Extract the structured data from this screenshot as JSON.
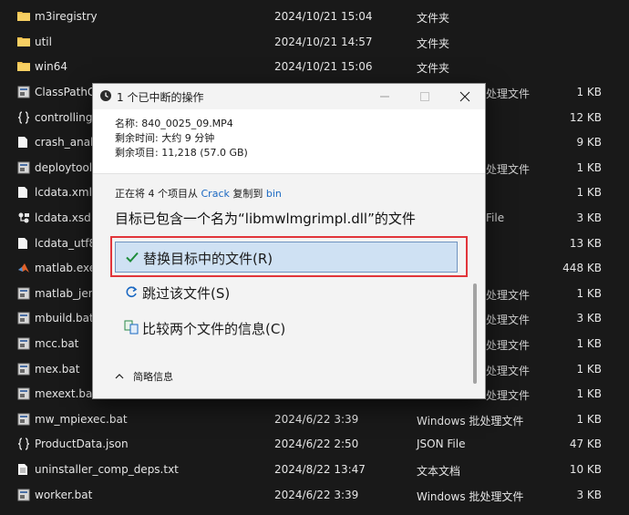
{
  "files": [
    {
      "name": "m3iregistry",
      "date": "2024/10/21 15:04",
      "type": "文件夹",
      "size": "",
      "icon": "folder-icon"
    },
    {
      "name": "util",
      "date": "2024/10/21 14:57",
      "type": "文件夹",
      "size": "",
      "icon": "folder-icon"
    },
    {
      "name": "win64",
      "date": "2024/10/21 15:06",
      "type": "文件夹",
      "size": "",
      "icon": "folder-icon"
    },
    {
      "name": "ClassPathG",
      "date": "",
      "type": "处理文件",
      "size": "1 KB",
      "icon": "batch-file-icon"
    },
    {
      "name": "controlling",
      "date": "",
      "type": "",
      "size": "12 KB",
      "icon": "json-file-icon"
    },
    {
      "name": "crash_analy",
      "date": "",
      "type": "",
      "size": "9 KB",
      "icon": "file-icon"
    },
    {
      "name": "deploytool.",
      "date": "",
      "type": "处理文件",
      "size": "1 KB",
      "icon": "batch-file-icon"
    },
    {
      "name": "lcdata.xml",
      "date": "",
      "type": "",
      "size": "1 KB",
      "icon": "file-icon"
    },
    {
      "name": "lcdata.xsd",
      "date": "",
      "type": "File",
      "size": "3 KB",
      "icon": "xsd-file-icon"
    },
    {
      "name": "lcdata_utf8",
      "date": "",
      "type": "",
      "size": "13 KB",
      "icon": "file-icon"
    },
    {
      "name": "matlab.exe",
      "date": "",
      "type": "",
      "size": "448 KB",
      "icon": "matlab-icon"
    },
    {
      "name": "matlab_jen",
      "date": "",
      "type": "处理文件",
      "size": "1 KB",
      "icon": "batch-file-icon"
    },
    {
      "name": "mbuild.bat",
      "date": "",
      "type": "处理文件",
      "size": "3 KB",
      "icon": "batch-file-icon"
    },
    {
      "name": "mcc.bat",
      "date": "",
      "type": "处理文件",
      "size": "1 KB",
      "icon": "batch-file-icon"
    },
    {
      "name": "mex.bat",
      "date": "",
      "type": "处理文件",
      "size": "1 KB",
      "icon": "batch-file-icon"
    },
    {
      "name": "mexext.bat",
      "date": "",
      "type": "处理文件",
      "size": "1 KB",
      "icon": "batch-file-icon"
    },
    {
      "name": "mw_mpiexec.bat",
      "date": "2024/6/22 3:39",
      "type": "Windows 批处理文件",
      "size": "1 KB",
      "icon": "batch-file-icon"
    },
    {
      "name": "ProductData.json",
      "date": "2024/6/22 2:50",
      "type": "JSON File",
      "size": "47 KB",
      "icon": "json-file-icon"
    },
    {
      "name": "uninstaller_comp_deps.txt",
      "date": "2024/8/22 13:47",
      "type": "文本文档",
      "size": "10 KB",
      "icon": "text-file-icon"
    },
    {
      "name": "worker.bat",
      "date": "2024/6/22 3:39",
      "type": "Windows 批处理文件",
      "size": "3 KB",
      "icon": "batch-file-icon"
    }
  ],
  "dialog": {
    "title": "1 个已中断的操作",
    "info": {
      "name": "名称: 840_0025_09.MP4",
      "time_left": "剩余时间: 大约 9 分钟",
      "items_left": "剩余项目: 11,218 (57.0 GB)"
    },
    "copying": {
      "prefix": "正在将 4 个项目从 ",
      "source": "Crack",
      "middle": " 复制到 ",
      "dest": "bin"
    },
    "heading": "目标已包含一个名为“libmwlmgrimpl.dll”的文件",
    "options": {
      "replace": "替换目标中的文件(R)",
      "skip": "跳过该文件(S)",
      "compare": "比较两个文件的信息(C)"
    },
    "details": "简略信息"
  },
  "colors": {
    "accent": "#1a68c2",
    "highlight": "#e1353a",
    "folder": "#f2c14e",
    "check": "#1e8c3a"
  }
}
